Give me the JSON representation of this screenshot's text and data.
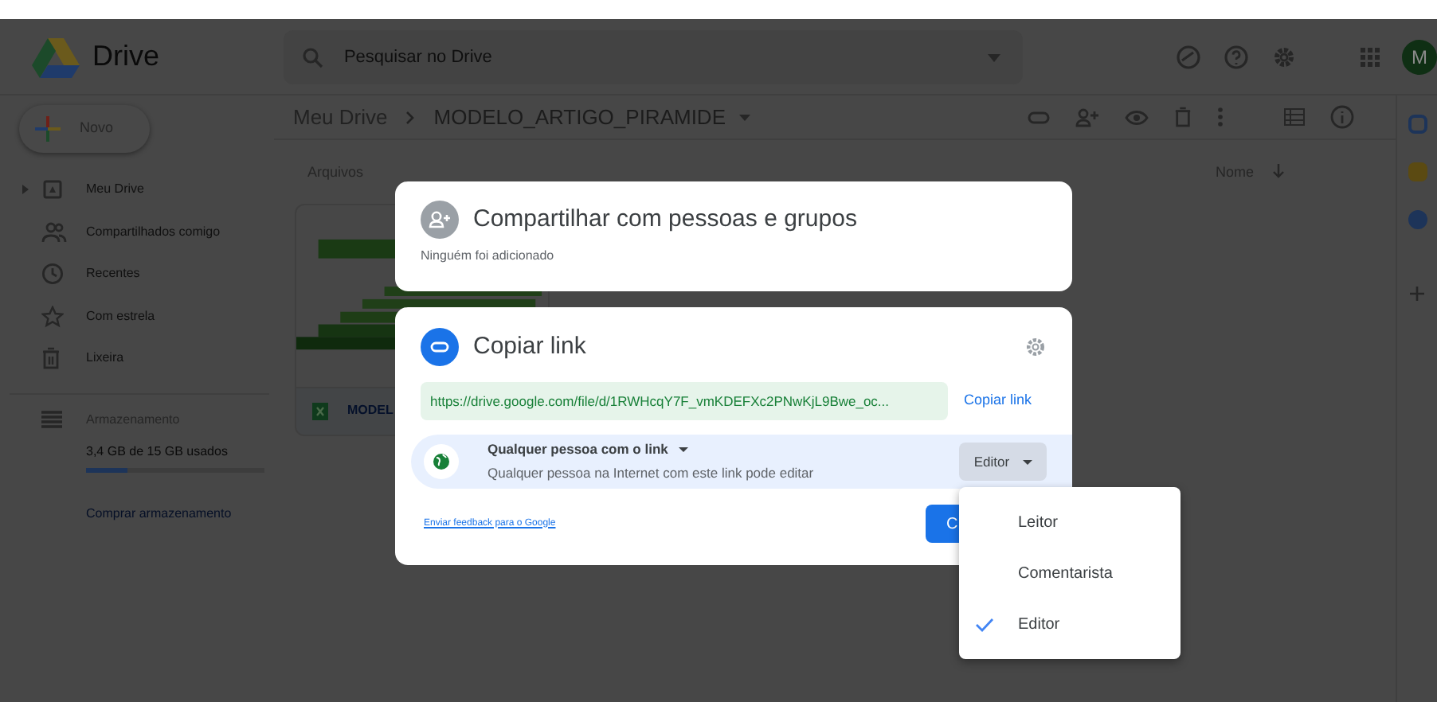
{
  "app": {
    "title": "Drive"
  },
  "search": {
    "placeholder": "Pesquisar no Drive"
  },
  "avatar": {
    "initial": "M"
  },
  "new_button": {
    "label": "Novo"
  },
  "sidebar": {
    "items": [
      {
        "label": "Meu Drive",
        "expandable": true
      },
      {
        "label": "Compartilhados comigo",
        "expandable": false
      },
      {
        "label": "Recentes",
        "expandable": false
      },
      {
        "label": "Com estrela",
        "expandable": false
      },
      {
        "label": "Lixeira",
        "expandable": false
      }
    ],
    "storage": {
      "label": "Armazenamento",
      "usage": "3,4 GB de 15 GB usados",
      "level": 0.23,
      "buy_link": "Comprar armazenamento"
    }
  },
  "breadcrumb": [
    "Meu Drive",
    "MODELO_ARTIGO_PIRAMIDE"
  ],
  "section_label": "Arquivos",
  "sort": {
    "label": "Nome"
  },
  "file": {
    "name": "MODEL"
  },
  "share_dialog": {
    "title": "Compartilhar com pessoas e grupos",
    "subtitle": "Ninguém foi adicionado"
  },
  "link_dialog": {
    "title": "Copiar link",
    "url": "https://drive.google.com/file/d/1RWHcqY7F_vmKDEFXc2PNwKjL9Bwe_oc...",
    "copy_link": "Copiar link",
    "access": {
      "scope": "Qualquer pessoa com o link",
      "description": "Qualquer pessoa na Internet com este link pode editar",
      "role": "Editor"
    },
    "feedback_link": "Enviar feedback para o Google",
    "done_button": "C"
  },
  "role_menu": [
    {
      "label": "Leitor",
      "selected": false
    },
    {
      "label": "Comentarista",
      "selected": false
    },
    {
      "label": "Editor",
      "selected": true
    }
  ]
}
